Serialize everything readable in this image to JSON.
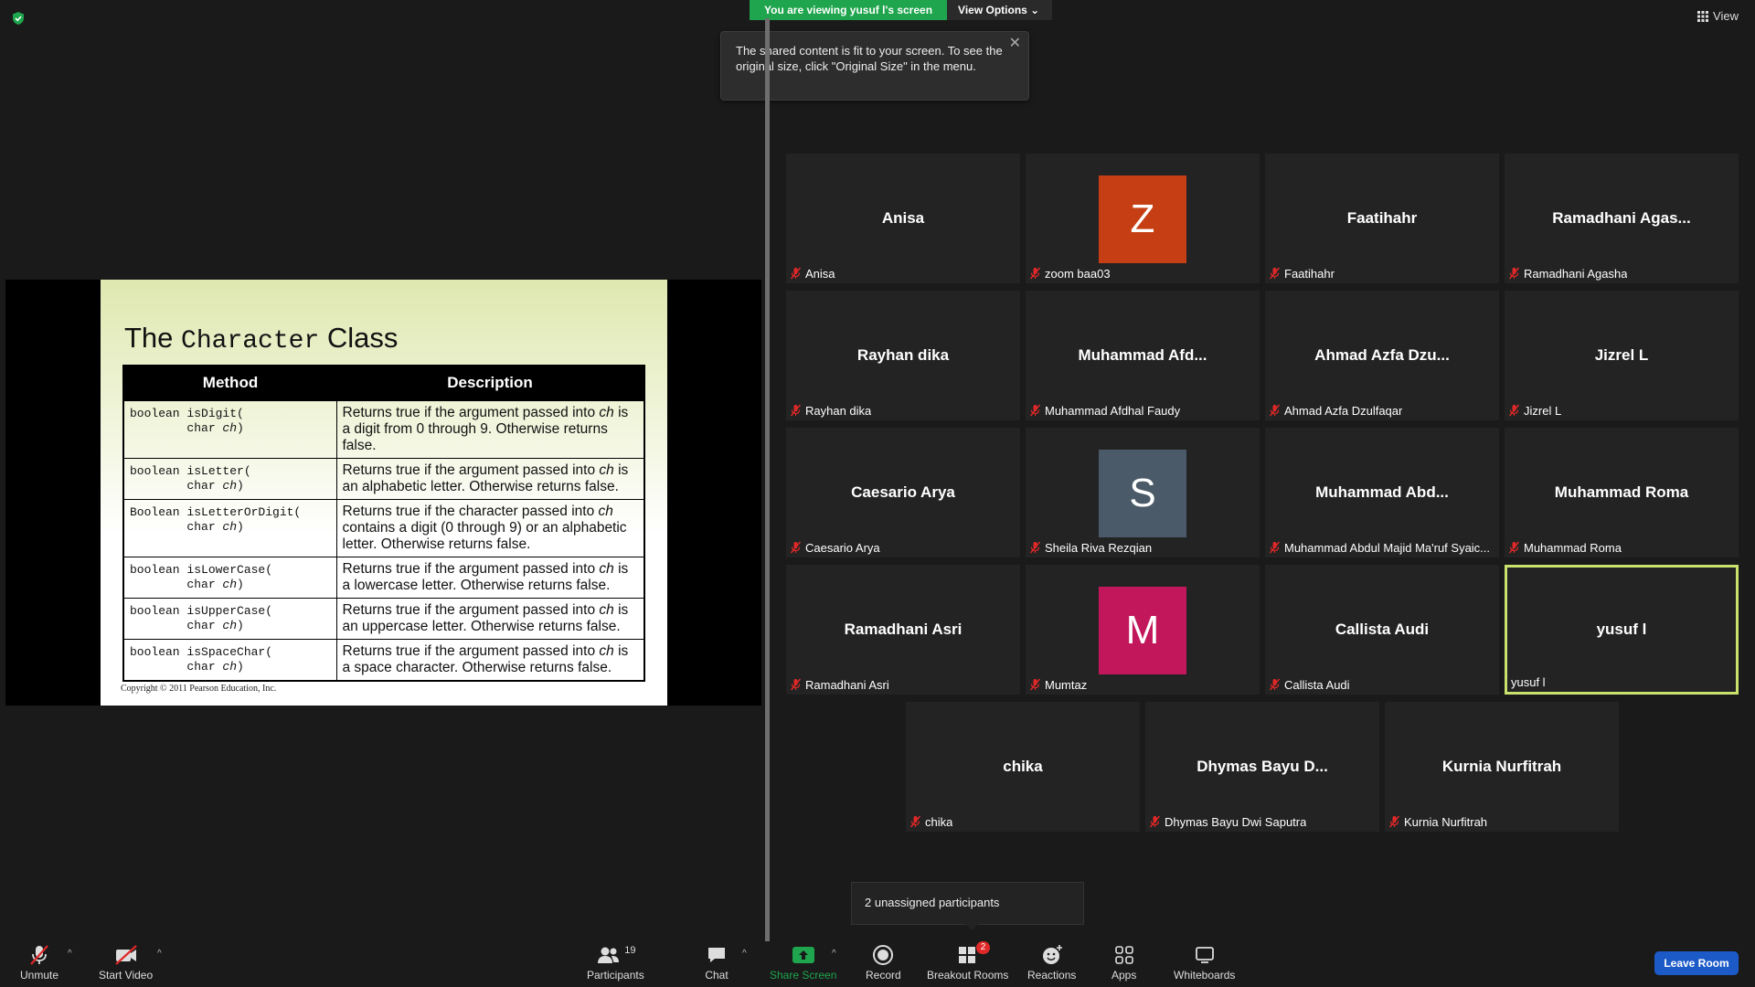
{
  "top": {
    "viewing_text": "You are viewing yusuf l's screen",
    "view_options": "View Options",
    "view_label": "View",
    "tooltip": "The shared content is fit to your screen. To see the original size, click \"Original Size\" in the menu."
  },
  "slide": {
    "title_a": "The ",
    "title_mono": "Character",
    "title_b": " Class",
    "header_method": "Method",
    "header_description": "Description",
    "rows": [
      {
        "method": "boolean isDigit(\n        char ch)",
        "desc": "Returns true if the argument passed into ch is a digit from 0 through 9. Otherwise returns false."
      },
      {
        "method": "boolean isLetter(\n        char ch)",
        "desc": "Returns true if the argument passed into ch is an alphabetic letter. Otherwise returns false."
      },
      {
        "method": "Boolean isLetterOrDigit(\n        char ch)",
        "desc": "Returns true if the character passed into ch contains a digit (0 through 9) or an alphabetic letter. Otherwise returns false."
      },
      {
        "method": "boolean isLowerCase(\n        char ch)",
        "desc": "Returns true if the argument passed into ch is a lowercase letter. Otherwise returns false."
      },
      {
        "method": "boolean isUpperCase(\n        char ch)",
        "desc": "Returns true if the argument passed into ch is an uppercase letter. Otherwise returns false."
      },
      {
        "method": "boolean isSpaceChar(\n        char ch)",
        "desc": "Returns true if the argument passed into ch is a space character. Otherwise returns false."
      }
    ],
    "copyright": "Copyright © 2011 Pearson Education, Inc."
  },
  "participants": [
    {
      "center": "Anisa",
      "label": "Anisa",
      "muted": true
    },
    {
      "avatar": "Z",
      "avatar_color": "#c53e14",
      "label": "zoom baa03",
      "muted": true
    },
    {
      "center": "Faatihahr",
      "label": "Faatihahr",
      "muted": true
    },
    {
      "center": "Ramadhani  Agas...",
      "label": "Ramadhani Agasha",
      "muted": true
    },
    {
      "center": "Rayhan dika",
      "label": "Rayhan dika",
      "muted": true
    },
    {
      "center": "Muhammad  Afd...",
      "label": "Muhammad Afdhal Faudy",
      "muted": true
    },
    {
      "center": "Ahmad  Azfa  Dzu...",
      "label": "Ahmad Azfa Dzulfaqar",
      "muted": true
    },
    {
      "center": "Jizrel L",
      "label": "Jizrel L",
      "muted": true
    },
    {
      "center": "Caesario Arya",
      "label": "Caesario Arya",
      "muted": true
    },
    {
      "avatar": "S",
      "avatar_color": "#4a5a68",
      "label": "Sheila Riva Rezqian",
      "muted": true
    },
    {
      "center": "Muhammad  Abd...",
      "label": "Muhammad Abdul Majid Ma'ruf Syaic...",
      "muted": true
    },
    {
      "center": "Muhammad Roma",
      "label": "Muhammad Roma",
      "muted": true
    },
    {
      "center": "Ramadhani Asri",
      "label": "Ramadhani Asri",
      "muted": true
    },
    {
      "avatar": "M",
      "avatar_color": "#c2185b",
      "label": "Mumtaz",
      "muted": true
    },
    {
      "center": "Callista Audi",
      "label": "Callista Audi",
      "muted": true
    },
    {
      "center": "yusuf l",
      "label": "yusuf l",
      "muted": false,
      "active": true
    },
    {
      "center": "chika",
      "label": "chika",
      "muted": true
    },
    {
      "center": "Dhymas  Bayu  D...",
      "label": "Dhymas Bayu Dwi Saputra",
      "muted": true
    },
    {
      "center": "Kurnia Nurfitrah",
      "label": "Kurnia Nurfitrah",
      "muted": true
    }
  ],
  "unassigned": "2 unassigned participants",
  "toolbar": {
    "unmute": "Unmute",
    "start_video": "Start Video",
    "participants": "Participants",
    "participants_count": "19",
    "chat": "Chat",
    "share_screen": "Share Screen",
    "record": "Record",
    "breakout_rooms": "Breakout Rooms",
    "breakout_badge": "2",
    "reactions": "Reactions",
    "apps": "Apps",
    "whiteboards": "Whiteboards",
    "leave_room": "Leave Room"
  },
  "colors": {
    "share_green": "#1ea54d",
    "active_speaker": "#c8e26d",
    "leave_blue": "#1c5ac8",
    "mute_red": "#e02828"
  }
}
